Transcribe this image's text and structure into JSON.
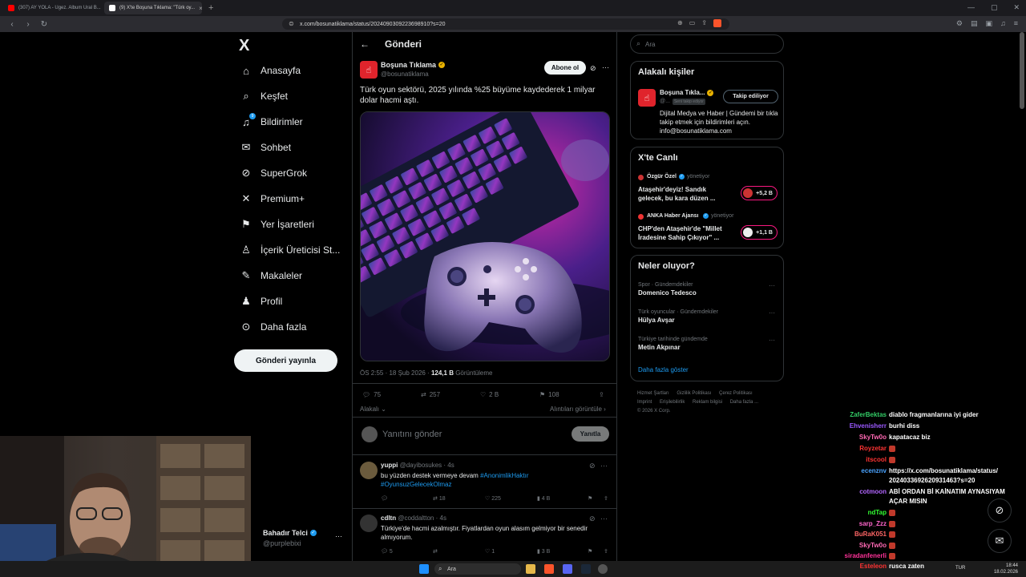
{
  "browser": {
    "tabs": [
      {
        "label": "(307) AY YOLA - Ugez. Album Ural B...",
        "favicon_color": "#ff0000",
        "active": false
      },
      {
        "label": "(9) X'te Boşuna Tıklama: \"Türk oy...",
        "favicon_color": "#ffffff",
        "active": true
      }
    ],
    "new_tab": "+",
    "url": "x.com/bosunatiklama/status/2024090309223698910?s=20"
  },
  "nav": {
    "logo": "X",
    "items": [
      {
        "label": "Anasayfa",
        "icon": "home-icon"
      },
      {
        "label": "Keşfet",
        "icon": "search-icon"
      },
      {
        "label": "Bildirimler",
        "icon": "bell-icon",
        "badge": "9"
      },
      {
        "label": "Sohbet",
        "icon": "mail-icon"
      },
      {
        "label": "SuperGrok",
        "icon": "grok-icon"
      },
      {
        "label": "Premium+",
        "icon": "x-icon"
      },
      {
        "label": "Yer İşaretleri",
        "icon": "bookmark-icon"
      },
      {
        "label": "İçerik Üreticisi St...",
        "icon": "creator-icon"
      },
      {
        "label": "Makaleler",
        "icon": "article-icon"
      },
      {
        "label": "Profil",
        "icon": "person-icon"
      },
      {
        "label": "Daha fazla",
        "icon": "more-icon"
      }
    ],
    "post_button": "Gönderi yayınla",
    "profile": {
      "name": "Bahadır Telci",
      "handle": "@purplebixi"
    }
  },
  "post": {
    "page_title": "Gönderi",
    "author": "Boşuna Tıklama",
    "handle": "@bosunatiklama",
    "follow": "Abone ol",
    "text": "Türk oyun sektörü, 2025 yılında %25 büyüme kaydederek 1 milyar dolar hacmi aştı.",
    "time": "ÖS 2:55 · 18 Şub 2026 · ",
    "views_num": "124,1 B",
    "views_label": " Görüntüleme",
    "replies": "75",
    "reposts": "257",
    "likes": "2 B",
    "bookmarks": "108",
    "related": "Alakalı",
    "related_views": "Alıntıları görüntüle",
    "reply_placeholder": "Yanıtını gönder",
    "reply_button": "Yanıtla"
  },
  "replies": [
    {
      "name": "yuppi",
      "handle": "@dayibosukes",
      "time": "· 4s",
      "text": "bu yüzden destek vermeye devam ",
      "tags": "#AnonimlikHaktır #OyunsuzGelecekOlmaz",
      "replies": "",
      "reposts": "18",
      "likes": "225",
      "views": "4 B"
    },
    {
      "name": "cdltn",
      "handle": "@coddaltton",
      "time": "· 4s",
      "text": "Türkiye'de hacmi azalmıştır. Fiyatlardan oyun alasım gelmiyor bir senedir almıyorum.",
      "replies": "5",
      "reposts": "",
      "likes": "1",
      "views": "3 B"
    }
  ],
  "sidebar": {
    "search_placeholder": "Ara",
    "people": {
      "title": "Alakalı kişiler",
      "name": "Boşuna Tıkla...",
      "handle": "@...",
      "follows_you": "Seni takip ediyor",
      "follow_state": "Takip ediliyor",
      "bio": "Dijital Medya ve Haber | Gündemi bir tıkla takip etmek için bildirimleri açın. info@bosunatiklama.com"
    },
    "live": {
      "title": "X'te Canlı",
      "items": [
        {
          "host": "Özgür Özel",
          "role": "yönetiyor",
          "title": "Ataşehir'deyiz! Sandık gelecek, bu kara düzen ...",
          "count": "+5,2 B"
        },
        {
          "host": "ANKA Haber Ajansı",
          "role": "yönetiyor",
          "title": "CHP'den Ataşehir'de \"Millet İradesine Sahip Çıkıyor\" ...",
          "count": "+1,1 B"
        }
      ]
    },
    "trends": {
      "title": "Neler oluyor?",
      "items": [
        {
          "context": "Spor · Gündemdekiler",
          "topic": "Domenico Tedesco"
        },
        {
          "context": "Türk oyuncular · Gündemdekiler",
          "topic": "Hülya Avşar"
        },
        {
          "context": "Türkiye tarihinde gündemde",
          "topic": "Metin Akpınar"
        }
      ],
      "more": "Daha fazla göster"
    },
    "footer": [
      "Hizmet Şartları",
      "Gizlilik Politikası",
      "Çerez Politikası",
      "Imprint",
      "Erişilebilirlik",
      "Reklam bilgisi",
      "Daha fazla ...",
      "© 2026 X Corp."
    ]
  },
  "chat": [
    {
      "user": "ZaferBektas",
      "color": "#33cc66",
      "msg": "diablo fragmanlarına iyi gider"
    },
    {
      "user": "Ehvenisherr",
      "color": "#9b59ff",
      "msg": "burhi diss"
    },
    {
      "user": "SkyTw0o",
      "color": "#ff69b4",
      "msg": "kapatacaz biz"
    },
    {
      "user": "Royzetar",
      "color": "#ff3333",
      "msg": "",
      "emote": true
    },
    {
      "user": "itscool",
      "color": "#ff3333",
      "msg": "",
      "emote": true
    },
    {
      "user": "ecenznv",
      "color": "#4aa3ff",
      "msg": "https://x.com/bosunatiklama/status/"
    },
    {
      "user": "",
      "color": "#fff",
      "msg": "2024033692620931463?s=20"
    },
    {
      "user": "cotmoon",
      "color": "#b266ff",
      "msg": "ABİ ORDAN Bİ KAİNATIM AYNASIYAM"
    },
    {
      "user": "",
      "color": "#fff",
      "msg": "AÇAR MISIN"
    },
    {
      "user": "ndTap",
      "color": "#33ff33",
      "msg": "",
      "emote": true
    },
    {
      "user": "sarp_Zzz",
      "color": "#ff66cc",
      "msg": "",
      "emote": true
    },
    {
      "user": "BuRaK051",
      "color": "#ff6666",
      "msg": "",
      "emote": true
    },
    {
      "user": "SkyTw0o",
      "color": "#ff69b4",
      "msg": "",
      "emote": true
    },
    {
      "user": "siradanfenerli",
      "color": "#ff3399",
      "msg": "",
      "emote": true
    },
    {
      "user": "Esteleon",
      "color": "#ff3333",
      "msg": "rusca zaten"
    }
  ],
  "taskbar": {
    "search": "Ara",
    "lang": "TUR",
    "time": "18:44",
    "date": "18.02.2026"
  }
}
